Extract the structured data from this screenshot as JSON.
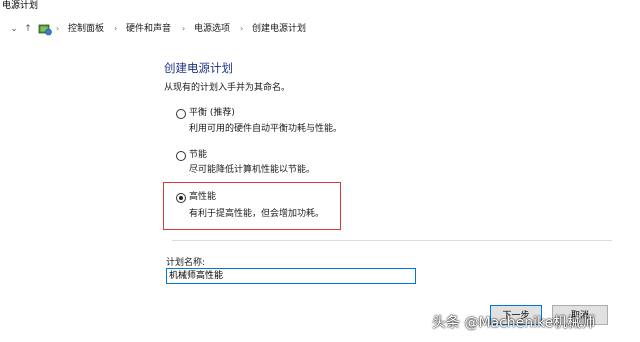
{
  "window": {
    "title": "电源计划"
  },
  "nav": {
    "back_icon": "chevron-down-icon",
    "up_icon": "up-arrow-icon",
    "breadcrumbs": [
      "控制面板",
      "硬件和声音",
      "电源选项",
      "创建电源计划"
    ]
  },
  "main": {
    "heading": "创建电源计划",
    "instruction": "从现有的计划入手并为其命名。",
    "options": [
      {
        "label": "平衡 (推荐)",
        "description": "利用可用的硬件自动平衡功耗与性能。",
        "selected": false
      },
      {
        "label": "节能",
        "description": "尽可能降低计算机性能以节能。",
        "selected": false
      },
      {
        "label": "高性能",
        "description": "有利于提高性能，但会增加功耗。",
        "selected": true
      }
    ],
    "name_field": {
      "label": "计划名称:",
      "value": "机械师高性能"
    }
  },
  "buttons": {
    "next": "下一步",
    "cancel": "取消"
  },
  "watermark": "头条 @Machenike机械师",
  "colors": {
    "highlight": "#d23a3a",
    "heading": "#1e3287",
    "focus": "#0078d7"
  }
}
